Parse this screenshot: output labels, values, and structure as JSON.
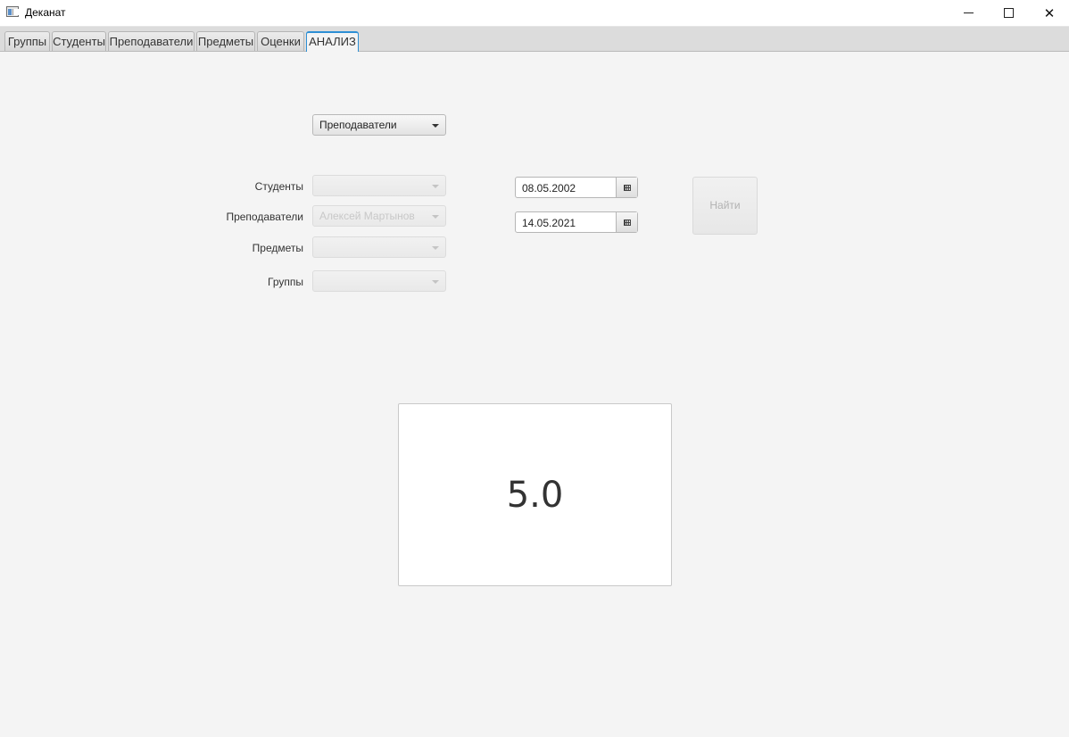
{
  "window": {
    "title": "Деканат",
    "minimize": "",
    "maximize": "",
    "close": "✕"
  },
  "tabs": [
    {
      "label": "Группы"
    },
    {
      "label": "Студенты"
    },
    {
      "label": "Преподаватели"
    },
    {
      "label": "Предметы"
    },
    {
      "label": "Оценки"
    },
    {
      "label": "АНАЛИЗ",
      "active": true
    }
  ],
  "analysis": {
    "mode_select": {
      "value": "Преподаватели"
    },
    "filters": {
      "students": {
        "label": "Студенты",
        "value": ""
      },
      "teachers": {
        "label": "Преподаватели",
        "value": "Алексей Мартынов"
      },
      "subjects": {
        "label": "Предметы",
        "value": ""
      },
      "groups": {
        "label": "Группы",
        "value": ""
      }
    },
    "date_from": "08.05.2002",
    "date_to": "14.05.2021",
    "find_button": "Найти",
    "result": "5.0"
  }
}
